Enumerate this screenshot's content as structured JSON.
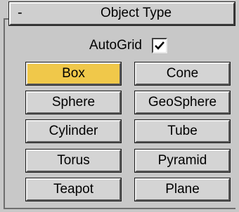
{
  "rollout": {
    "toggle": "-",
    "title": "Object Type"
  },
  "autogrid": {
    "label": "AutoGrid",
    "checked": true
  },
  "buttons": [
    {
      "label": "Box",
      "active": true
    },
    {
      "label": "Cone",
      "active": false
    },
    {
      "label": "Sphere",
      "active": false
    },
    {
      "label": "GeoSphere",
      "active": false
    },
    {
      "label": "Cylinder",
      "active": false
    },
    {
      "label": "Tube",
      "active": false
    },
    {
      "label": "Torus",
      "active": false
    },
    {
      "label": "Pyramid",
      "active": false
    },
    {
      "label": "Teapot",
      "active": false
    },
    {
      "label": "Plane",
      "active": false
    }
  ],
  "colors": {
    "panel_bg": "#c8c8c8",
    "active_button": "#f0c84a",
    "button_bg": "#d4d4d4"
  }
}
